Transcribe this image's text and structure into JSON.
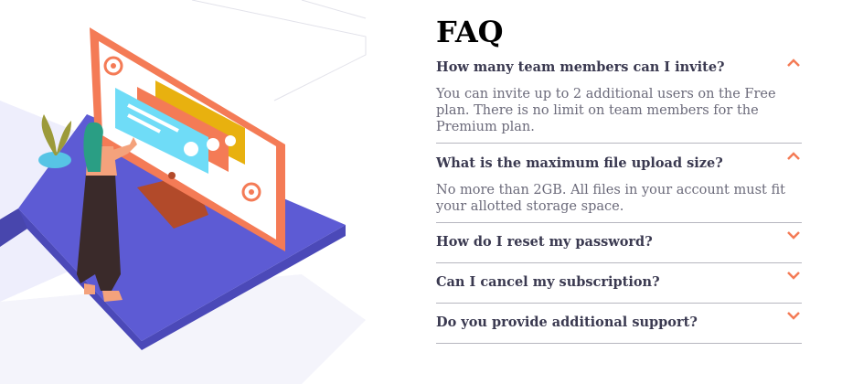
{
  "title": "FAQ",
  "faq": [
    {
      "question": "How many team members can I invite?",
      "answer": "You can invite up to 2 additional users on the Free plan. There is no limit on team members for the Premium plan.",
      "expanded": true
    },
    {
      "question": "What is the maximum file upload size?",
      "answer": "No more than 2GB. All files in your account must fit your allotted storage space.",
      "expanded": true
    },
    {
      "question": "How do I reset my password?",
      "answer": "",
      "expanded": false
    },
    {
      "question": "Can I cancel my subscription?",
      "answer": "",
      "expanded": false
    },
    {
      "question": "Do you provide additional support?",
      "answer": "",
      "expanded": false
    }
  ],
  "colors": {
    "accent": "#f47b56",
    "platform": "#5d5bd4",
    "question": "#3a3950",
    "answer": "#6b6a7a",
    "divider": "#b6b6bf"
  },
  "icons": {
    "open": "chevron-up-icon",
    "closed": "chevron-down-icon",
    "email": "at-sign-icon"
  }
}
